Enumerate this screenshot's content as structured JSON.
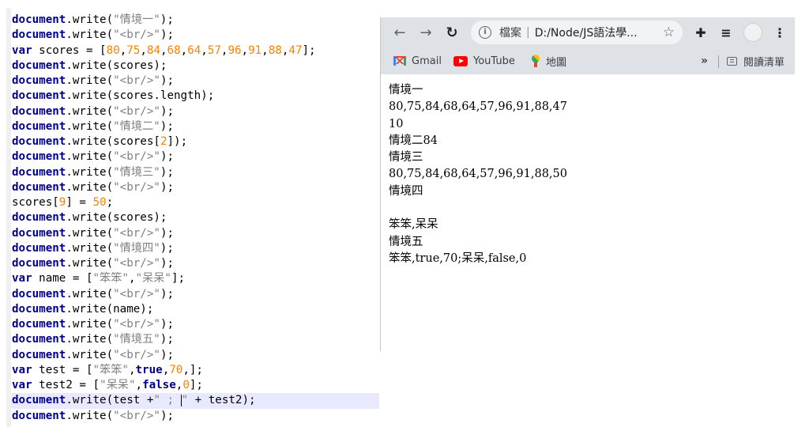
{
  "editor": {
    "lines": [
      [
        [
          "obj",
          "document"
        ],
        [
          "p",
          ".write("
        ],
        [
          "str",
          "\"情境一\""
        ],
        [
          "p",
          ");"
        ]
      ],
      [
        [
          "obj",
          "document"
        ],
        [
          "p",
          ".write("
        ],
        [
          "str",
          "\"<br/>\""
        ],
        [
          "p",
          ");"
        ]
      ],
      [
        [
          "kw",
          "var"
        ],
        [
          "p",
          " scores = ["
        ],
        [
          "num",
          "80"
        ],
        [
          "p",
          ","
        ],
        [
          "num",
          "75"
        ],
        [
          "p",
          ","
        ],
        [
          "num",
          "84"
        ],
        [
          "p",
          ","
        ],
        [
          "num",
          "68"
        ],
        [
          "p",
          ","
        ],
        [
          "num",
          "64"
        ],
        [
          "p",
          ","
        ],
        [
          "num",
          "57"
        ],
        [
          "p",
          ","
        ],
        [
          "num",
          "96"
        ],
        [
          "p",
          ","
        ],
        [
          "num",
          "91"
        ],
        [
          "p",
          ","
        ],
        [
          "num",
          "88"
        ],
        [
          "p",
          ","
        ],
        [
          "num",
          "47"
        ],
        [
          "p",
          "];"
        ]
      ],
      [
        [
          "obj",
          "document"
        ],
        [
          "p",
          ".write(scores);"
        ]
      ],
      [
        [
          "obj",
          "document"
        ],
        [
          "p",
          ".write("
        ],
        [
          "str",
          "\"<br/>\""
        ],
        [
          "p",
          ");"
        ]
      ],
      [
        [
          "obj",
          "document"
        ],
        [
          "p",
          ".write(scores.length);"
        ]
      ],
      [
        [
          "obj",
          "document"
        ],
        [
          "p",
          ".write("
        ],
        [
          "str",
          "\"<br/>\""
        ],
        [
          "p",
          ");"
        ]
      ],
      [
        [
          "obj",
          "document"
        ],
        [
          "p",
          ".write("
        ],
        [
          "str",
          "\"情境二\""
        ],
        [
          "p",
          ");"
        ]
      ],
      [
        [
          "obj",
          "document"
        ],
        [
          "p",
          ".write(scores["
        ],
        [
          "num",
          "2"
        ],
        [
          "p",
          "]);"
        ]
      ],
      [
        [
          "obj",
          "document"
        ],
        [
          "p",
          ".write("
        ],
        [
          "str",
          "\"<br/>\""
        ],
        [
          "p",
          ");"
        ]
      ],
      [
        [
          "obj",
          "document"
        ],
        [
          "p",
          ".write("
        ],
        [
          "str",
          "\"情境三\""
        ],
        [
          "p",
          ");"
        ]
      ],
      [
        [
          "obj",
          "document"
        ],
        [
          "p",
          ".write("
        ],
        [
          "str",
          "\"<br/>\""
        ],
        [
          "p",
          ");"
        ]
      ],
      [
        [
          "p",
          "scores["
        ],
        [
          "num",
          "9"
        ],
        [
          "p",
          "] = "
        ],
        [
          "num",
          "50"
        ],
        [
          "p",
          ";"
        ]
      ],
      [
        [
          "obj",
          "document"
        ],
        [
          "p",
          ".write(scores);"
        ]
      ],
      [
        [
          "obj",
          "document"
        ],
        [
          "p",
          ".write("
        ],
        [
          "str",
          "\"<br/>\""
        ],
        [
          "p",
          ");"
        ]
      ],
      [
        [
          "obj",
          "document"
        ],
        [
          "p",
          ".write("
        ],
        [
          "str",
          "\"情境四\""
        ],
        [
          "p",
          ");"
        ]
      ],
      [
        [
          "obj",
          "document"
        ],
        [
          "p",
          ".write("
        ],
        [
          "str",
          "\"<br/>\""
        ],
        [
          "p",
          ");"
        ]
      ],
      [
        [
          "kw",
          "var"
        ],
        [
          "p",
          " name = ["
        ],
        [
          "str",
          "\"笨笨\""
        ],
        [
          "p",
          ","
        ],
        [
          "str",
          "\"呆呆\""
        ],
        [
          "p",
          "];"
        ]
      ],
      [
        [
          "obj",
          "document"
        ],
        [
          "p",
          ".write("
        ],
        [
          "str",
          "\"<br/>\""
        ],
        [
          "p",
          ");"
        ]
      ],
      [
        [
          "obj",
          "document"
        ],
        [
          "p",
          ".write(name);"
        ]
      ],
      [
        [
          "obj",
          "document"
        ],
        [
          "p",
          ".write("
        ],
        [
          "str",
          "\"<br/>\""
        ],
        [
          "p",
          ");"
        ]
      ],
      [
        [
          "obj",
          "document"
        ],
        [
          "p",
          ".write("
        ],
        [
          "str",
          "\"情境五\""
        ],
        [
          "p",
          ");"
        ]
      ],
      [
        [
          "obj",
          "document"
        ],
        [
          "p",
          ".write("
        ],
        [
          "str",
          "\"<br/>\""
        ],
        [
          "p",
          ");"
        ]
      ],
      [
        [
          "kw",
          "var"
        ],
        [
          "p",
          " test = ["
        ],
        [
          "str",
          "\"笨笨\""
        ],
        [
          "p",
          ","
        ],
        [
          "lit",
          "true"
        ],
        [
          "p",
          ","
        ],
        [
          "num",
          "70"
        ],
        [
          "p",
          ",];"
        ]
      ],
      [
        [
          "kw",
          "var"
        ],
        [
          "p",
          " test2 = ["
        ],
        [
          "str",
          "\"呆呆\""
        ],
        [
          "p",
          ","
        ],
        [
          "lit",
          "false"
        ],
        [
          "p",
          ","
        ],
        [
          "num",
          "0"
        ],
        [
          "p",
          "];"
        ]
      ],
      [
        [
          "obj",
          "document"
        ],
        [
          "p",
          ".write(test +"
        ],
        [
          "str",
          "\" ; "
        ],
        [
          "cursor",
          ""
        ],
        [
          "str",
          "\""
        ],
        [
          "p",
          " + test2);"
        ]
      ],
      [
        [
          "obj",
          "document"
        ],
        [
          "p",
          ".write("
        ],
        [
          "str",
          "\"<br/>\""
        ],
        [
          "p",
          ");"
        ]
      ]
    ],
    "active_line": 25
  },
  "browser": {
    "back_icon": "←",
    "forward_icon": "→",
    "reload_icon": "↻",
    "omnibox": {
      "info_icon": "i",
      "label": "檔案",
      "separator": "|",
      "url": "D:/Node/JS語法學...",
      "star_icon": "☆"
    },
    "extensions_icon": "✚",
    "media_icon": "≡",
    "menu_icon": "⋮",
    "bookmarks": {
      "gmail": "Gmail",
      "youtube": "YouTube",
      "maps": "地圖",
      "more": "»",
      "reading_list": "閱讀清單"
    },
    "output_lines": [
      "情境一",
      "80,75,84,68,64,57,96,91,88,47",
      "10",
      "情境二84",
      "情境三",
      "80,75,84,68,64,57,96,91,88,50",
      "情境四",
      "",
      "笨笨,呆呆",
      "情境五",
      "笨笨,true,70;呆呆,false,0"
    ]
  }
}
